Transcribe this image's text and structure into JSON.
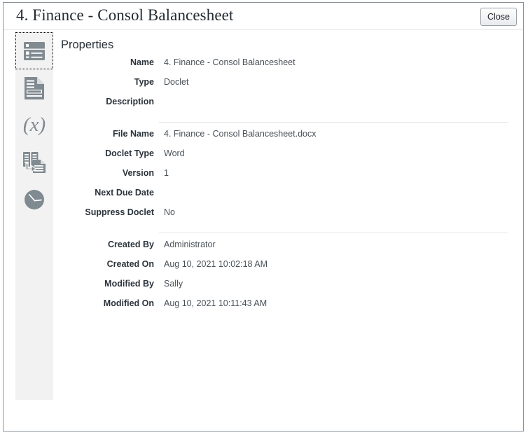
{
  "dialog": {
    "title": "4. Finance - Consol Balancesheet",
    "close_label": "Close"
  },
  "sidebar": {
    "items": [
      {
        "name": "properties",
        "icon": "properties-list-icon",
        "selected": true
      },
      {
        "name": "content",
        "icon": "document-icon",
        "selected": false
      },
      {
        "name": "variables",
        "icon": "variables-x-icon",
        "selected": false
      },
      {
        "name": "references",
        "icon": "reference-copy-icon",
        "selected": false
      },
      {
        "name": "history",
        "icon": "clock-history-icon",
        "selected": false
      }
    ]
  },
  "properties": {
    "heading": "Properties",
    "groups": [
      {
        "fields": [
          {
            "label": "Name",
            "value": "4. Finance - Consol Balancesheet"
          },
          {
            "label": "Type",
            "value": "Doclet"
          },
          {
            "label": "Description",
            "value": ""
          }
        ]
      },
      {
        "fields": [
          {
            "label": "File Name",
            "value": "4. Finance - Consol Balancesheet.docx"
          },
          {
            "label": "Doclet Type",
            "value": "Word"
          },
          {
            "label": "Version",
            "value": "1"
          },
          {
            "label": "Next Due Date",
            "value": ""
          },
          {
            "label": "Suppress Doclet",
            "value": "No"
          }
        ]
      },
      {
        "fields": [
          {
            "label": "Created By",
            "value": "Administrator"
          },
          {
            "label": "Created On",
            "value": "Aug 10, 2021 10:02:18 AM"
          },
          {
            "label": "Modified By",
            "value": "Sally"
          },
          {
            "label": "Modified On",
            "value": "Aug 10, 2021 10:11:43 AM"
          }
        ]
      }
    ]
  },
  "colors": {
    "icon_gray": "#808a91",
    "rail_bg": "#f2f2f2",
    "label_text": "#2b333b",
    "value_text": "#4a5158",
    "frame_border": "#8a9199"
  }
}
